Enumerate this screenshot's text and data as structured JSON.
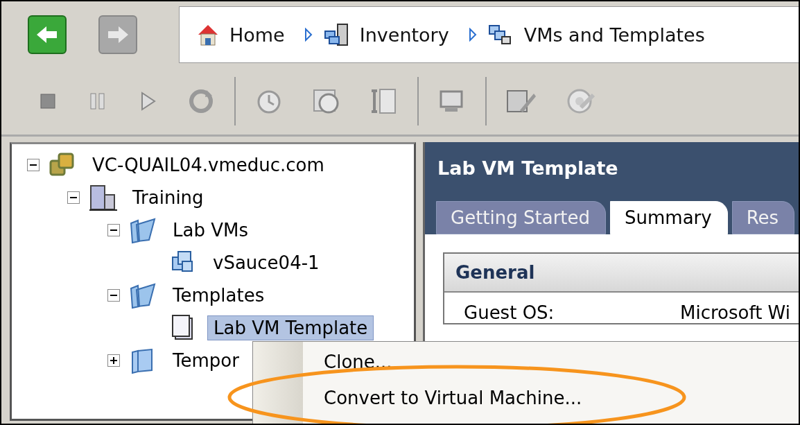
{
  "breadcrumb": [
    {
      "label": "Home",
      "kind": "home"
    },
    {
      "label": "Inventory",
      "kind": "inventory"
    },
    {
      "label": "VMs and Templates",
      "kind": "vms"
    }
  ],
  "tree": [
    {
      "label": "VC-QUAIL04.vmeduc.com",
      "kind": "vcenter",
      "expanded": true,
      "selected": false,
      "children": [
        {
          "label": "Training",
          "kind": "datacenter",
          "expanded": true,
          "selected": false,
          "children": [
            {
              "label": "Lab VMs",
              "kind": "folder",
              "expanded": true,
              "selected": false,
              "children": [
                {
                  "label": "vSauce04-1",
                  "kind": "vm",
                  "selected": false
                }
              ]
            },
            {
              "label": "Templates",
              "kind": "folder",
              "expanded": true,
              "selected": false,
              "children": [
                {
                  "label": "Lab VM Template",
                  "kind": "template",
                  "selected": true
                }
              ]
            },
            {
              "label": "Tempor",
              "kind": "folder",
              "expanded": false,
              "selected": false
            }
          ]
        }
      ]
    }
  ],
  "panel": {
    "title": "Lab VM Template",
    "tabs": [
      {
        "label": "Getting Started",
        "selected": false
      },
      {
        "label": "Summary",
        "selected": true
      },
      {
        "label": "Res",
        "selected": false
      }
    ],
    "section": {
      "title": "General",
      "rows": [
        {
          "label": "Guest OS:",
          "value": "Microsoft Wi"
        }
      ]
    }
  },
  "context_menu": [
    {
      "label": "Clone...",
      "circled": false
    },
    {
      "label": "Convert to Virtual Machine...",
      "circled": true
    }
  ]
}
